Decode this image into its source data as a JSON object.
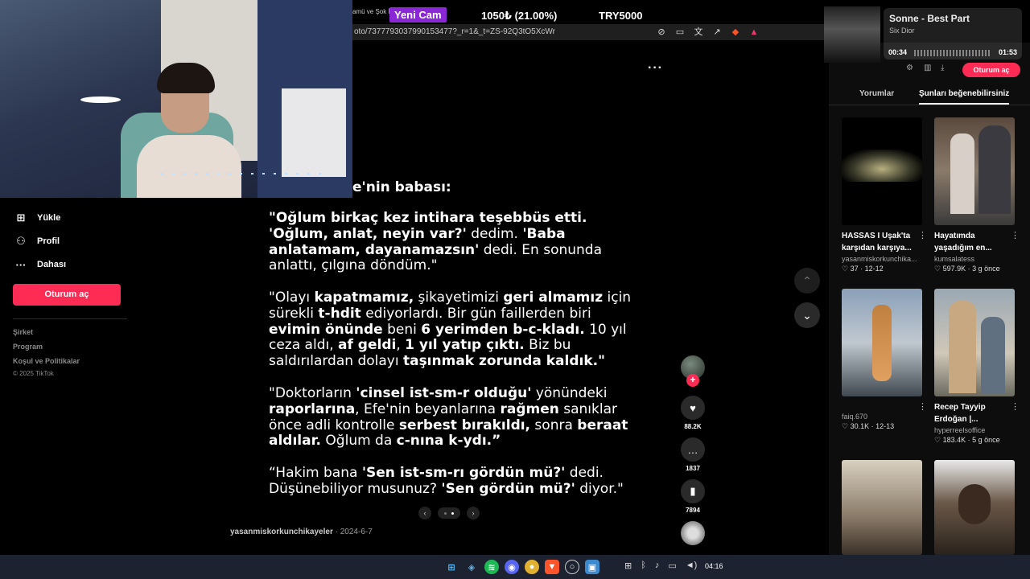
{
  "stream": {
    "small_text": "amü ve Şok İ",
    "yeni_cam": "Yeni Cam",
    "donation": "1050₺ (21.00%)",
    "try": "TRY5000"
  },
  "browser": {
    "url": "oto/7377793037990153477?_r=1&_t=ZS-92Q3tO5XcWr"
  },
  "sidebar": {
    "items": [
      {
        "label": "Yükle",
        "icon": "plus-square-icon"
      },
      {
        "label": "Profil",
        "icon": "user-icon"
      },
      {
        "label": "Dahası",
        "icon": "more-icon"
      }
    ],
    "login_button": "Oturum aç",
    "footer": [
      "Şirket",
      "Program",
      "Koşul ve Politikalar"
    ],
    "copyright": "© 2025 TikTok"
  },
  "post": {
    "heading": "e'nin babası:",
    "more": "···",
    "author": "yasanmiskorkunchikayeler",
    "date": " · 2024-6-7"
  },
  "actions": {
    "likes": "88.2K",
    "comments": "1837",
    "saves": "7894"
  },
  "right_panel": {
    "login_button": "Oturum aç",
    "tabs": [
      "Yorumlar",
      "Şunları beğenebilirsiniz"
    ],
    "cards": [
      {
        "title1": "HASSAS I Uşak'ta",
        "title2": "karşıdan karşıya...",
        "user": "yasanmiskorkunchika...",
        "meta": "♡ 37 · 12-12"
      },
      {
        "title1": "Hayatımda",
        "title2": "yaşadığım en...",
        "user": "kumsalatess",
        "meta": "♡ 597.9K · 3 g önce"
      },
      {
        "title1": "",
        "title2": "",
        "user": "faiq.670",
        "meta": "♡ 30.1K · 12-13"
      },
      {
        "title1": "Recep Tayyip",
        "title2": "Erdoğan |...",
        "user": "hyperreelsoffice",
        "meta": "♡ 183.4K · 5 g önce"
      }
    ]
  },
  "spotify": {
    "title": "Sonne - Best Part",
    "artist": "Six Dior",
    "elapsed": "00:34",
    "total": "01:53"
  },
  "taskbar": {
    "time": "04:16"
  }
}
